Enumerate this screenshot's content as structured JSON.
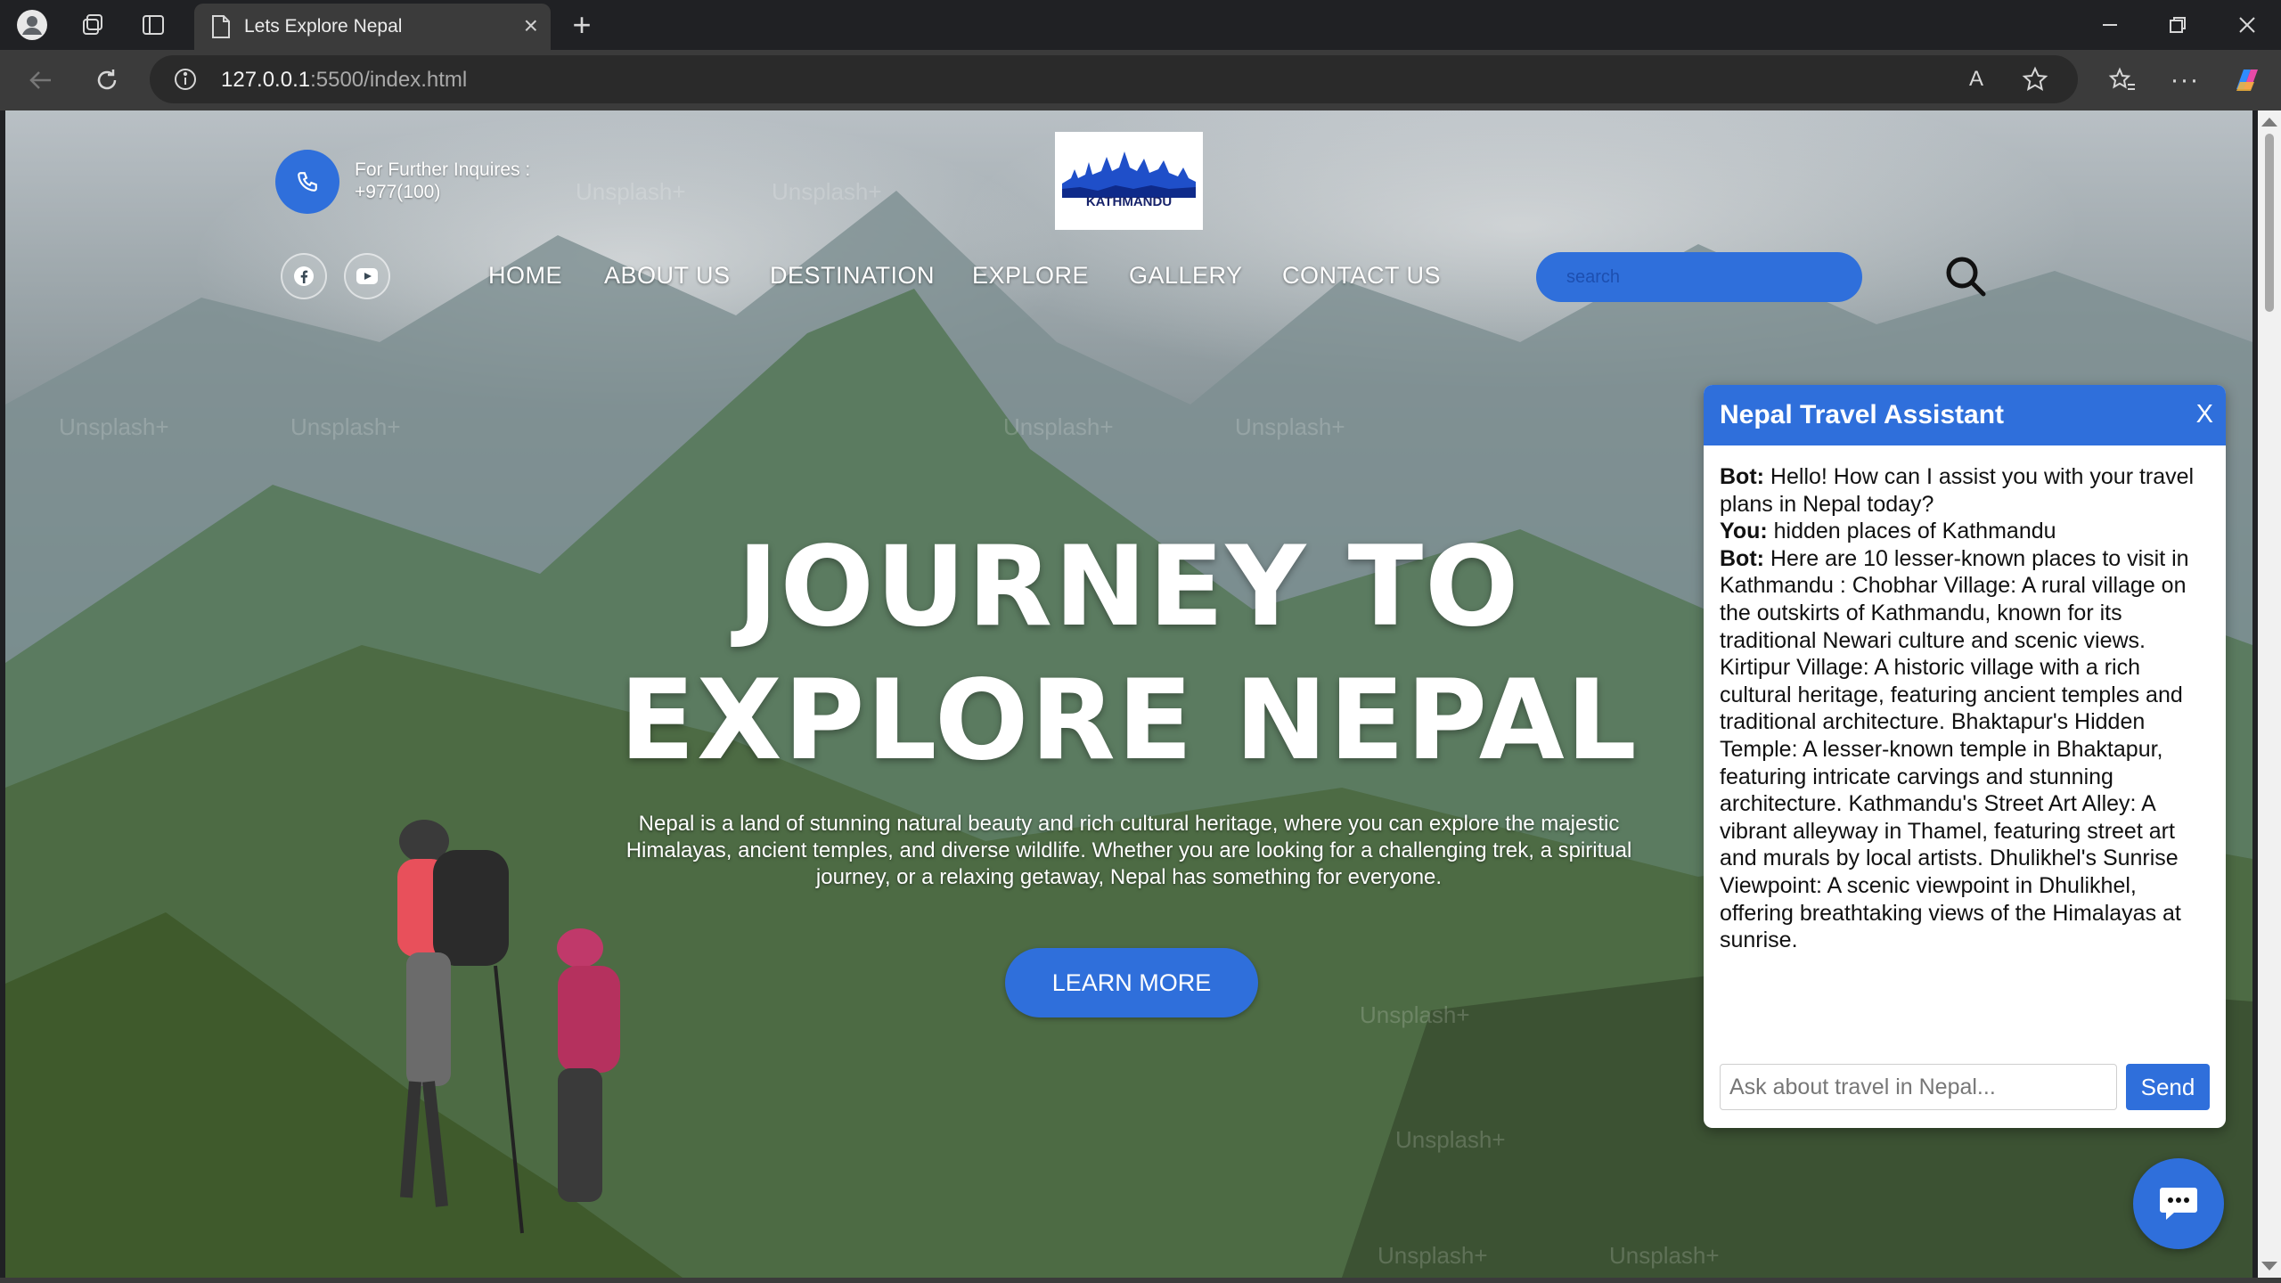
{
  "browser": {
    "tab_title": "Lets Explore Nepal",
    "tab_close": "×",
    "new_tab": "+",
    "url_host": "127.0.0.1",
    "url_path": ":5500/index.html"
  },
  "header": {
    "inquiry_label": "For Further Inquires :",
    "phone_number": "+977(100)",
    "logo_text": "KATHMANDU"
  },
  "nav": {
    "items": [
      "HOME",
      "ABOUT US",
      "DESTINATION",
      "EXPLORE",
      "GALLERY",
      "CONTACT US"
    ]
  },
  "search": {
    "placeholder": "search"
  },
  "hero": {
    "title_line1": "JOURNEY TO",
    "title_line2": "EXPLORE NEPAL",
    "description": "Nepal is a land of stunning natural beauty and rich cultural heritage, where you can explore the majestic Himalayas, ancient temples, and diverse wildlife. Whether you are looking for a challenging trek, a spiritual journey, or a relaxing getaway, Nepal has something for everyone.",
    "button_label": "LEARN MORE"
  },
  "watermark": "Unsplash+",
  "chat": {
    "title": "Nepal Travel Assistant",
    "close_label": "X",
    "messages": [
      {
        "sender": "Bot:",
        "text": " Hello! How can I assist you with your travel plans in Nepal today?"
      },
      {
        "sender": "You:",
        "text": " hidden places of Kathmandu"
      },
      {
        "sender": "Bot:",
        "text": " Here are 10 lesser-known places to visit in Kathmandu : Chobhar Village: A rural village on the outskirts of Kathmandu, known for its traditional Newari culture and scenic views. Kirtipur Village: A historic village with a rich cultural heritage, featuring ancient temples and traditional architecture. Bhaktapur's Hidden Temple: A lesser-known temple in Bhaktapur, featuring intricate carvings and stunning architecture. Kathmandu's Street Art Alley: A vibrant alleyway in Thamel, featuring street art and murals by local artists. Dhulikhel's Sunrise Viewpoint: A scenic viewpoint in Dhulikhel, offering breathtaking views of the Himalayas at sunrise."
      }
    ],
    "input_placeholder": "Ask about travel in Nepal...",
    "send_label": "Send"
  },
  "colors": {
    "accent": "#2f6fdb",
    "chrome_dark": "#202124",
    "chrome_mid": "#3b3b3b"
  }
}
